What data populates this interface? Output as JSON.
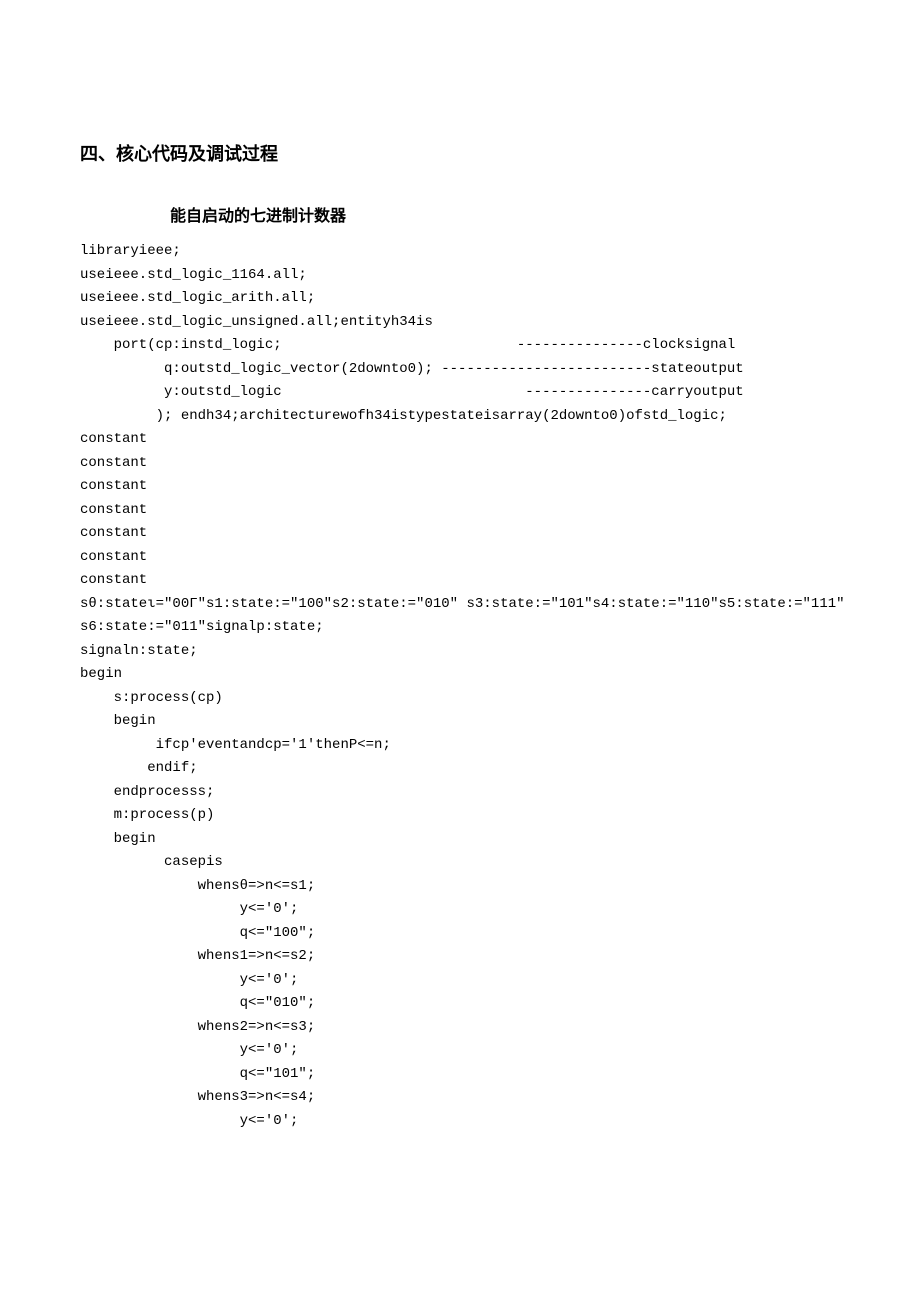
{
  "section_heading": "四、核心代码及调试过程",
  "subheading": "能自启动的七进制计数器",
  "code_lines": [
    "libraryieee;",
    "useieee.std_logic_1164.all;",
    "useieee.std_logic_arith.all;",
    "useieee.std_logic_unsigned.all;entityh34is",
    "    port(cp:instd_logic;                            ---------------clocksignal",
    "          q:outstd_logic_vector(2downto0); -------------------------stateoutput",
    "          y:outstd_logic                             ---------------carryoutput",
    "         ); endh34;architecturewofh34istypestateisarray(2downto0)ofstd_logic;",
    "constant",
    "constant",
    "constant",
    "constant",
    "constant",
    "constant",
    "constant",
    "sθ:stateι=\"00Γ\"s1:state:=\"100\"s2:state:=\"010\" s3:state:=\"101\"s4:state:=\"110\"s5:state:=\"111\"",
    "s6:state:=\"011\"signalp:state;",
    "signaln:state;",
    "begin",
    "    s:process(cp)",
    "    begin",
    "         ifcp'eventandcp='1'thenP<=n;",
    "        endif;",
    "    endprocesss;",
    "    m:process(p)",
    "    begin",
    "          casepis",
    "              whensθ=>n<=s1;",
    "                   y<='0';",
    "                   q<=\"100\";",
    "              whens1=>n<=s2;",
    "                   y<='0';",
    "                   q<=\"010\";",
    "              whens2=>n<=s3;",
    "                   y<='0';",
    "                   q<=\"101\";",
    "              whens3=>n<=s4;",
    "                   y<='0';"
  ]
}
